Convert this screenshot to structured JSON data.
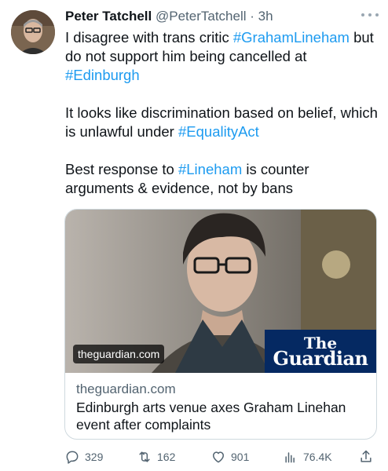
{
  "tweet": {
    "author_name": "Peter Tatchell",
    "author_handle": "@PeterTatchell",
    "separator": "·",
    "time": "3h",
    "paragraph1": {
      "text_a": "I disagree with trans critic ",
      "tag_a": "#GrahamLineham",
      "text_b": " but do not support him being cancelled at ",
      "tag_b": "#Edinburgh"
    },
    "paragraph2": {
      "text_a": "It looks like discrimination based on belief, which is unlawful under ",
      "tag_a": "#EqualityAct"
    },
    "paragraph3": {
      "text_a": "Best response to ",
      "tag_a": "#Lineham",
      "text_b": " is counter arguments & evidence, not by bans"
    }
  },
  "card": {
    "image_domain_badge": "theguardian.com",
    "logo_line1": "The",
    "logo_line2": "Guardian",
    "domain": "theguardian.com",
    "title": "Edinburgh arts venue axes Graham Linehan event after complaints"
  },
  "actions": {
    "replies": "329",
    "retweets": "162",
    "likes": "901",
    "views": "76.4K"
  },
  "colors": {
    "link": "#1d9bf0",
    "secondary": "#536471",
    "text": "#0f1419",
    "guardian_blue": "#052962"
  },
  "icons": [
    "more-icon",
    "reply-icon",
    "retweet-icon",
    "like-icon",
    "views-icon",
    "share-icon"
  ]
}
